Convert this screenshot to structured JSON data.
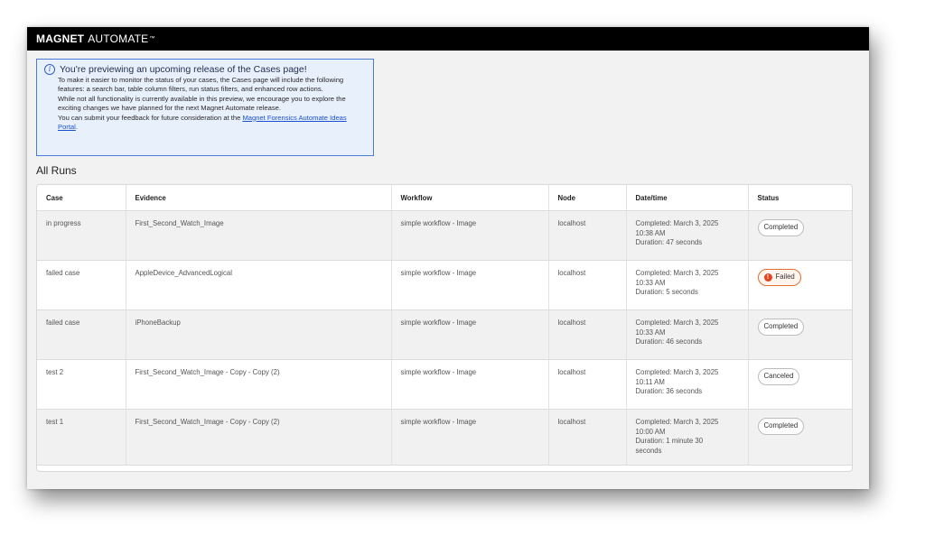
{
  "app": {
    "brand_bold": "MAGNET",
    "brand_light": "AUTOMATE",
    "trademark": "™"
  },
  "preview_notice": {
    "icon": "info-icon",
    "title": "You're previewing an upcoming release of the Cases page!",
    "paragraph1": "To make it easier to monitor the status of your cases, the Cases page will include the following features: a search bar, table column filters, run status filters, and enhanced row actions.",
    "paragraph2": "While not all functionality is currently available in this preview, we encourage you to explore the exciting changes we have planned for the next Magnet Automate release.",
    "paragraph3_prefix": "You can submit your feedback for future consideration at the ",
    "link_text": "Magnet Forensics Automate Ideas Portal",
    "paragraph3_suffix": "."
  },
  "section_title": "All Runs",
  "table": {
    "columns": [
      "Case",
      "Evidence",
      "Workflow",
      "Node",
      "Date/time",
      "Status"
    ],
    "rows": [
      {
        "case": "in progress",
        "evidence": "First_Second_Watch_Image",
        "workflow": "simple workflow - Image",
        "node": "localhost",
        "datetime": "Completed: March 3, 2025\n10:38 AM\nDuration: 47 seconds",
        "status": "Completed"
      },
      {
        "case": "failed case",
        "evidence": "AppleDevice_AdvancedLogical",
        "workflow": "simple workflow - Image",
        "node": "localhost",
        "datetime": "Completed: March 3, 2025\n10:33 AM\nDuration: 5 seconds",
        "status": "Failed"
      },
      {
        "case": "failed case",
        "evidence": "iPhoneBackup",
        "workflow": "simple workflow - Image",
        "node": "localhost",
        "datetime": "Completed: March 3, 2025\n10:33 AM\nDuration: 46 seconds",
        "status": "Completed"
      },
      {
        "case": "test 2",
        "evidence": "First_Second_Watch_Image - Copy - Copy (2)",
        "workflow": "simple workflow - Image",
        "node": "localhost",
        "datetime": "Completed: March 3, 2025\n10:11 AM\nDuration: 36 seconds",
        "status": "Canceled"
      },
      {
        "case": "test 1",
        "evidence": "First_Second_Watch_Image - Copy - Copy (2)",
        "workflow": "simple workflow - Image",
        "node": "localhost",
        "datetime": "Completed: March 3, 2025\n10:00 AM\nDuration: 1 minute 30\nseconds",
        "status": "Completed"
      }
    ]
  },
  "colors": {
    "topbar": "#000000",
    "notice_border": "#4a7bd6",
    "notice_bg": "#e8f0fc",
    "failed_accent": "#e0451f"
  }
}
